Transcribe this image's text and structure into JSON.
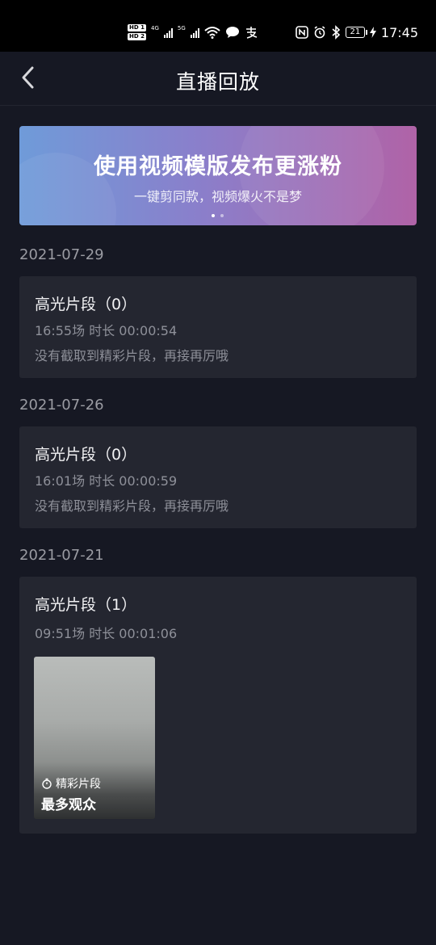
{
  "status_bar": {
    "hd1": "HD 1",
    "hd2": "HD 2",
    "net1": "4G",
    "net2": "5G",
    "battery": "21",
    "time": "17:45"
  },
  "navbar": {
    "title": "直播回放"
  },
  "banner": {
    "title": "使用视频模版发布更涨粉",
    "subtitle": "一键剪同款，视频爆火不是梦",
    "page_count": 2,
    "active_page": 1
  },
  "sessions": [
    {
      "date": "2021-07-29",
      "title": "高光片段（0）",
      "meta": "16:55场 时长 00:00:54",
      "note": "没有截取到精彩片段，再接再厉哦"
    },
    {
      "date": "2021-07-26",
      "title": "高光片段（0）",
      "meta": "16:01场 时长 00:00:59",
      "note": "没有截取到精彩片段，再接再厉哦"
    },
    {
      "date": "2021-07-21",
      "title": "高光片段（1）",
      "meta": "09:51场 时长 00:01:06",
      "clips": [
        {
          "tag": "精彩片段",
          "caption": "最多观众"
        }
      ]
    }
  ],
  "colors": {
    "background": "#161823",
    "card": "#242630",
    "muted_text": "#8e9099",
    "banner_gradient_start": "#6f9bd9",
    "banner_gradient_end": "#b063a7"
  },
  "icons": {
    "back": "chevron-left-icon",
    "clip_tag": "timer-icon"
  }
}
